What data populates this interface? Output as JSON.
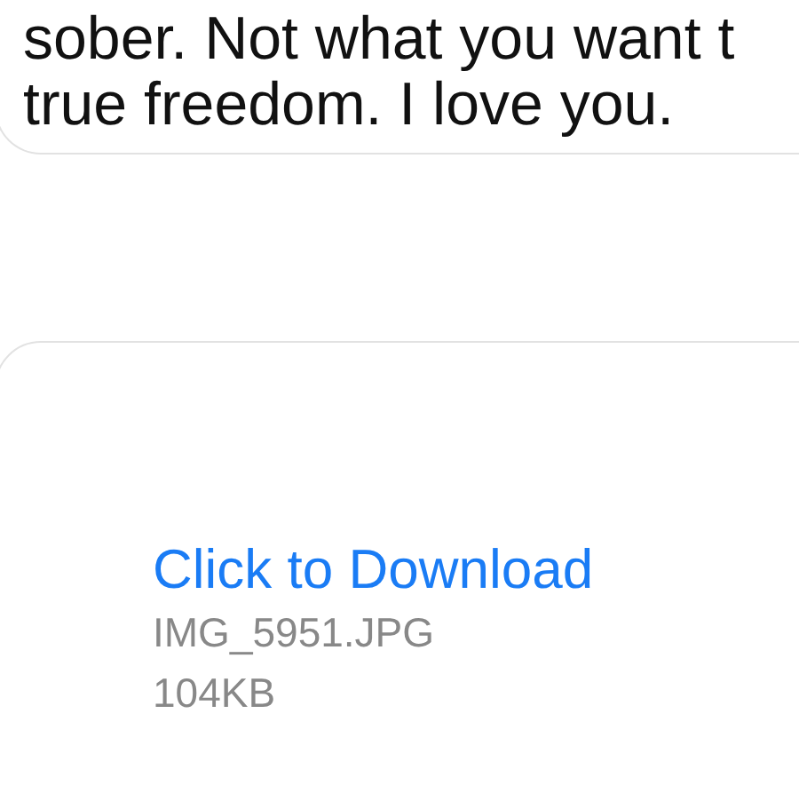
{
  "messages": [
    {
      "kind": "text",
      "lines": [
        "sober. Not what you want t",
        "true freedom. I love you."
      ]
    },
    {
      "kind": "attachment",
      "action": "Click to Download",
      "filename": "IMG_5951.JPG",
      "size": "104KB"
    }
  ]
}
